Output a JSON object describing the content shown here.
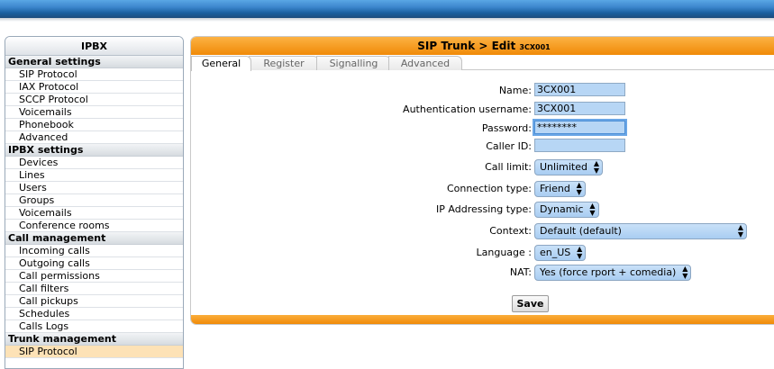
{
  "sidebar": {
    "title": "IPBX",
    "sections": [
      {
        "title": "General settings",
        "items": [
          "SIP Protocol",
          "IAX Protocol",
          "SCCP Protocol",
          "Voicemails",
          "Phonebook",
          "Advanced"
        ]
      },
      {
        "title": "IPBX settings",
        "items": [
          "Devices",
          "Lines",
          "Users",
          "Groups",
          "Voicemails",
          "Conference rooms"
        ]
      },
      {
        "title": "Call management",
        "items": [
          "Incoming calls",
          "Outgoing calls",
          "Call permissions",
          "Call filters",
          "Call pickups",
          "Schedules",
          "Calls Logs"
        ]
      },
      {
        "title": "Trunk management",
        "items": [
          "SIP Protocol"
        ]
      }
    ]
  },
  "main": {
    "title": "SIP Trunk > Edit",
    "title_small": "3CX001",
    "tabs": [
      "General",
      "Register",
      "Signalling",
      "Advanced"
    ],
    "active_tab": "General"
  },
  "form": {
    "name_label": "Name:",
    "name_value": "3CX001",
    "auth_label": "Authentication username:",
    "auth_value": "3CX001",
    "password_label": "Password:",
    "password_value": "********",
    "callerid_label": "Caller ID:",
    "callerid_value": "",
    "calllimit_label": "Call limit:",
    "calllimit_value": "Unlimited",
    "conntype_label": "Connection type:",
    "conntype_value": "Friend",
    "ipaddr_label": "IP Addressing type:",
    "ipaddr_value": "Dynamic",
    "context_label": "Context:",
    "context_value": "Default (default)",
    "language_label": "Language :",
    "language_value": "en_US",
    "nat_label": "NAT:",
    "nat_value": "Yes (force rport + comedia)",
    "save_label": "Save"
  },
  "icons": {
    "select_arrows": "updown-arrows-icon"
  },
  "colors": {
    "header_orange": "#f5930d",
    "topbar_blue": "#2f78c1",
    "input_blue": "#b7d6f5",
    "active_item": "#fde2b6"
  }
}
